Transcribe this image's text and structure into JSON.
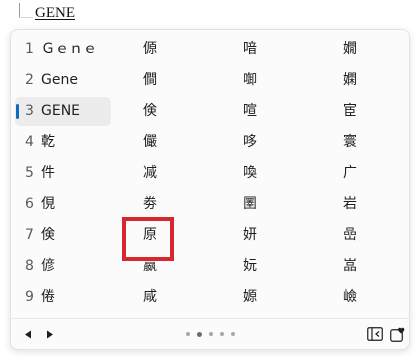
{
  "composition": {
    "text": "GENE"
  },
  "candidates": {
    "selected_index": 2,
    "rows": [
      {
        "num": "1",
        "items": [
          "Ｇｅｎｅ",
          "傆",
          "喑",
          "嫺"
        ]
      },
      {
        "num": "2",
        "items": [
          "Gene",
          "僴",
          "啣",
          "嫻"
        ]
      },
      {
        "num": "3",
        "items": [
          "GENE",
          "倹",
          "喧",
          "宦"
        ]
      },
      {
        "num": "4",
        "items": [
          "乾",
          "儼",
          "哆",
          "寰"
        ]
      },
      {
        "num": "5",
        "items": [
          "件",
          "减",
          "喚",
          "广"
        ]
      },
      {
        "num": "6",
        "items": [
          "俔",
          "劵",
          "圛",
          "岩"
        ]
      },
      {
        "num": "7",
        "items": [
          "倹",
          "原",
          "妍",
          "嵒"
        ]
      },
      {
        "num": "8",
        "items": [
          "偐",
          "嬴",
          "妧",
          "嵓"
        ]
      },
      {
        "num": "9",
        "items": [
          "倦",
          "咸",
          "嫄",
          "嶮"
        ]
      }
    ]
  },
  "footer": {
    "prev_icon": "triangle-left-icon",
    "next_icon": "triangle-right-icon",
    "page_count": 5,
    "active_page": 1,
    "dock_icon": "dock-left-icon",
    "emoji_icon": "heart-icon"
  },
  "colors": {
    "selection_bar": "#0f6cbd",
    "highlight_box": "#d8262f"
  }
}
